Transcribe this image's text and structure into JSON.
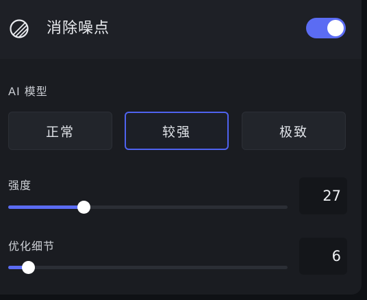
{
  "header": {
    "title": "消除噪点",
    "icon": "noise-reduction-icon",
    "toggle_on": true
  },
  "ai_model": {
    "label": "AI 模型",
    "options": [
      "正常",
      "较强",
      "极致"
    ],
    "selected_index": 1
  },
  "sliders": [
    {
      "label": "强度",
      "value": "27",
      "fraction": 0.27
    },
    {
      "label": "优化细节",
      "value": "6",
      "fraction": 0.07
    }
  ],
  "colors": {
    "accent": "#5b6cf3",
    "panel": "#1a1c21"
  }
}
